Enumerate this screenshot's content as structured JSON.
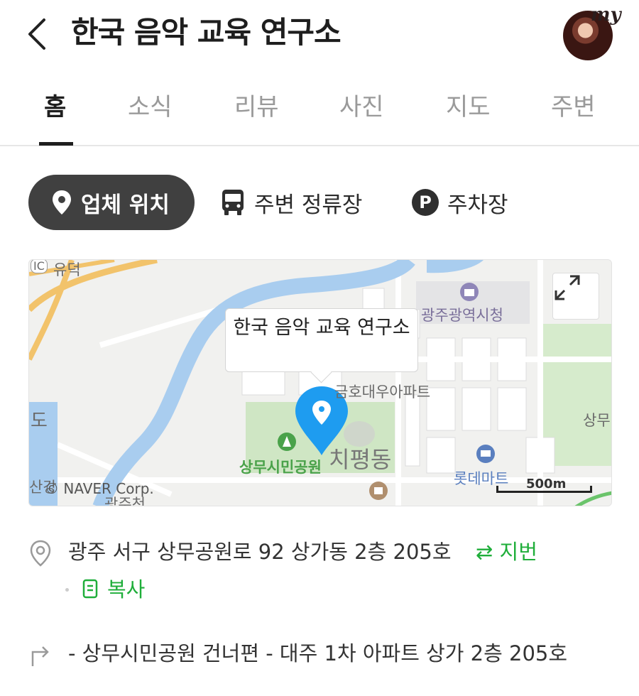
{
  "header": {
    "back_icon": "chevron-left-icon",
    "title": "한국 음악 교육 연구소",
    "avatar_badge": "my"
  },
  "tabs": [
    {
      "label": "홈",
      "active": true
    },
    {
      "label": "소식",
      "active": false
    },
    {
      "label": "리뷰",
      "active": false
    },
    {
      "label": "사진",
      "active": false
    },
    {
      "label": "지도",
      "active": false
    },
    {
      "label": "주변",
      "active": false
    }
  ],
  "chips": {
    "location": {
      "label": "업체 위치",
      "icon": "map-pin-icon"
    },
    "bus": {
      "label": "주변 정류장",
      "icon": "bus-icon"
    },
    "parking": {
      "label": "주차장",
      "icon_glyph": "P"
    }
  },
  "map": {
    "tooltip": "한국 음악 교육 연구소",
    "labels": {
      "ic_badge": "IC",
      "yudeok": "유덕",
      "city_hall": "광주광역시청",
      "apartment": "금호대우아파트",
      "park": "상무시민공원",
      "district": "치평동",
      "mart": "롯데마트",
      "left_do": "도",
      "left_sangang": "산강",
      "right_sangmu": "상무",
      "bottom": "광주천"
    },
    "copyright": "© NAVER Corp.",
    "scale": "500m",
    "colors": {
      "water": "#a9cdef",
      "road_major": "#f2c36b",
      "park": "#cfe6c4",
      "pin": "#1e9cf0"
    }
  },
  "info": {
    "address": "광주 서구 상무공원로 92 상가동 2층 205호",
    "jibun_label": "⇄ 지번",
    "copy_label": "복사",
    "directions": "- 상무시민공원 건너편 - 대주 1차 아파트 상가 2층 205호"
  }
}
